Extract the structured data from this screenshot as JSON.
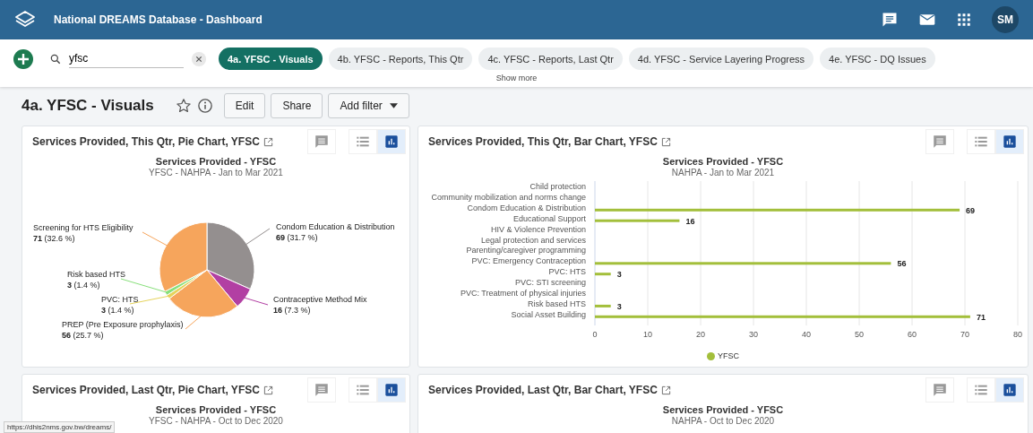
{
  "header": {
    "title": "National DREAMS Database - Dashboard",
    "avatar": "SM"
  },
  "dashboard_bar": {
    "search": {
      "value": "yfsc"
    },
    "dashboards": [
      {
        "label": "4a. YFSC - Visuals",
        "selected": true
      },
      {
        "label": "4b. YFSC - Reports, This Qtr",
        "selected": false
      },
      {
        "label": "4c. YFSC - Reports, Last Qtr",
        "selected": false
      },
      {
        "label": "4d. YFSC - Service Layering Progress",
        "selected": false
      },
      {
        "label": "4e. YFSC - DQ Issues",
        "selected": false
      }
    ],
    "show_more": "Show more"
  },
  "dashboard": {
    "title": "4a. YFSC - Visuals",
    "starred": false,
    "buttons": [
      "Edit",
      "Share"
    ],
    "add_filter": "Add filter"
  },
  "items": [
    {
      "title": "Services Provided, This Qtr, Pie Chart, YFSC",
      "views": [
        {
          "kind": "table",
          "selected": false
        },
        {
          "kind": "chart",
          "selected": true
        }
      ],
      "chart_title": "Services Provided - YFSC",
      "chart_subtitle": "YFSC - NAHPA - Jan to Mar 2021",
      "chart_data": {
        "type": "pie",
        "categories": [
          "Condom Education & Distribution",
          "Contraceptive Method Mix",
          "PREP (Pre Exposure prophylaxis)",
          "PVC: HTS",
          "Risk based HTS",
          "Screening for HTS Eligibility"
        ],
        "series": [
          {
            "values": [
              31.7,
              7.3,
              25.7,
              1.4,
              1.4,
              32.6
            ]
          }
        ],
        "value_labels": [
          "**69** (31.7 %)",
          "**16** (7.3 %)",
          "**56** (25.7 %)",
          "**3** (1.4 %)",
          "**3** (1.4 %)",
          "**71** (32.6 %)"
        ]
      }
    },
    {
      "title": "Services Provided, This Qtr, Bar Chart, YFSC",
      "views": [
        {
          "kind": "table",
          "selected": false
        },
        {
          "kind": "chart",
          "selected": true
        }
      ],
      "chart_title": "Services Provided - YFSC",
      "chart_subtitle": "NAHPA - Jan to Mar 2021",
      "chart_data": {
        "type": "bar",
        "orientation": "horizontal",
        "grid": true,
        "categories": [
          "Child protection",
          "Community mobilization and norms change",
          "Condom Education & Distribution",
          "Educational Support",
          "HIV & Violence Prevention",
          "Legal protection and services",
          "Parenting/caregiver programming",
          "PVC: Emergency Contraception",
          "PVC: HTS",
          "PVC: STI screening",
          "PVC: Treatment of physical injuries",
          "Risk based HTS",
          "Social Asset Building"
        ],
        "series": [
          {
            "name": "YFSC",
            "color": "#a3bf3b",
            "values": [
              null,
              null,
              69,
              16,
              null,
              null,
              null,
              56,
              3,
              null,
              null,
              3,
              71
            ]
          }
        ],
        "xlim": [
          0,
          80
        ],
        "xticks": [
          0,
          10,
          20,
          30,
          40,
          50,
          60,
          70,
          80
        ],
        "data_labels": true
      }
    },
    {
      "title": "Services Provided, Last Qtr, Pie Chart, YFSC",
      "views": [
        {
          "kind": "table",
          "selected": false
        },
        {
          "kind": "chart",
          "selected": true
        }
      ],
      "chart_title": "Services Provided - YFSC",
      "chart_subtitle": "YFSC - NAHPA - Oct to Dec 2020"
    },
    {
      "title": "Services Provided, Last Qtr, Bar Chart, YFSC",
      "views": [
        {
          "kind": "table",
          "selected": false
        },
        {
          "kind": "chart",
          "selected": true
        }
      ],
      "chart_title": "Services Provided - YFSC",
      "chart_subtitle": "NAHPA - Oct to Dec 2020"
    }
  ],
  "status_link": "https://dhis2nms.gov.bw/dreams/"
}
